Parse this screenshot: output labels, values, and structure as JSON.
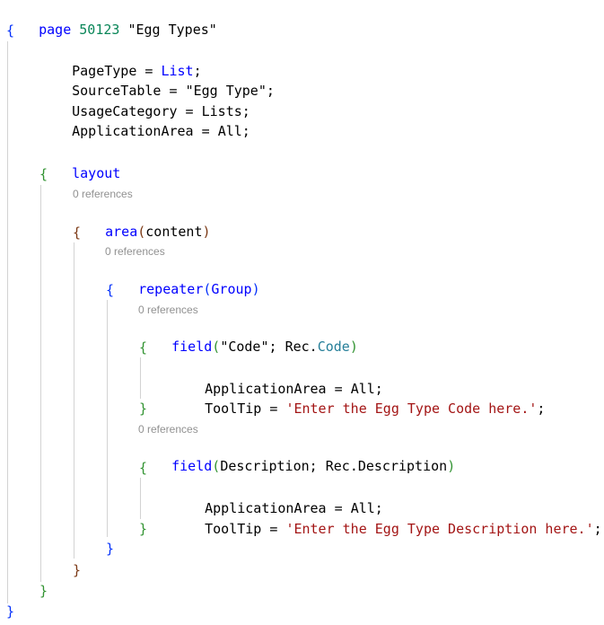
{
  "code": {
    "page_keyword": "page",
    "page_id": "50123",
    "page_name": "\"Egg Types\"",
    "properties": {
      "page_type_key": "PageType",
      "page_type_value": "List",
      "source_table_key": "SourceTable",
      "source_table_value": "\"Egg Type\"",
      "usage_category_key": "UsageCategory",
      "usage_category_value": "Lists",
      "application_area_key": "ApplicationArea",
      "application_area_value": "All"
    },
    "layout_keyword": "layout",
    "area_keyword": "area",
    "area_arg": "content",
    "repeater_keyword": "repeater",
    "repeater_arg": "Group",
    "field_keyword": "field",
    "fields": [
      {
        "name": "\"Code\"",
        "rec": "Rec",
        "source": "Code",
        "app_area_key": "ApplicationArea",
        "app_area_value": "All",
        "tooltip_key": "ToolTip",
        "tooltip_value": "'Enter the Egg Type Code here.'"
      },
      {
        "name": "Description",
        "rec": "Rec",
        "source": "Description",
        "app_area_key": "ApplicationArea",
        "app_area_value": "All",
        "tooltip_key": "ToolTip",
        "tooltip_value": "'Enter the Egg Type Description here.'"
      }
    ],
    "codelens": "0 references",
    "open_brace": "{",
    "close_brace": "}"
  },
  "colors": {
    "keyword": "#0000ff",
    "number": "#098658",
    "type": "#267f99",
    "string": "#a31515",
    "bracket_level_1": "#0431fa",
    "bracket_level_2": "#319331",
    "bracket_level_3": "#7b3814",
    "codelens": "#919191",
    "indent_guide": "#d3d3d3"
  }
}
